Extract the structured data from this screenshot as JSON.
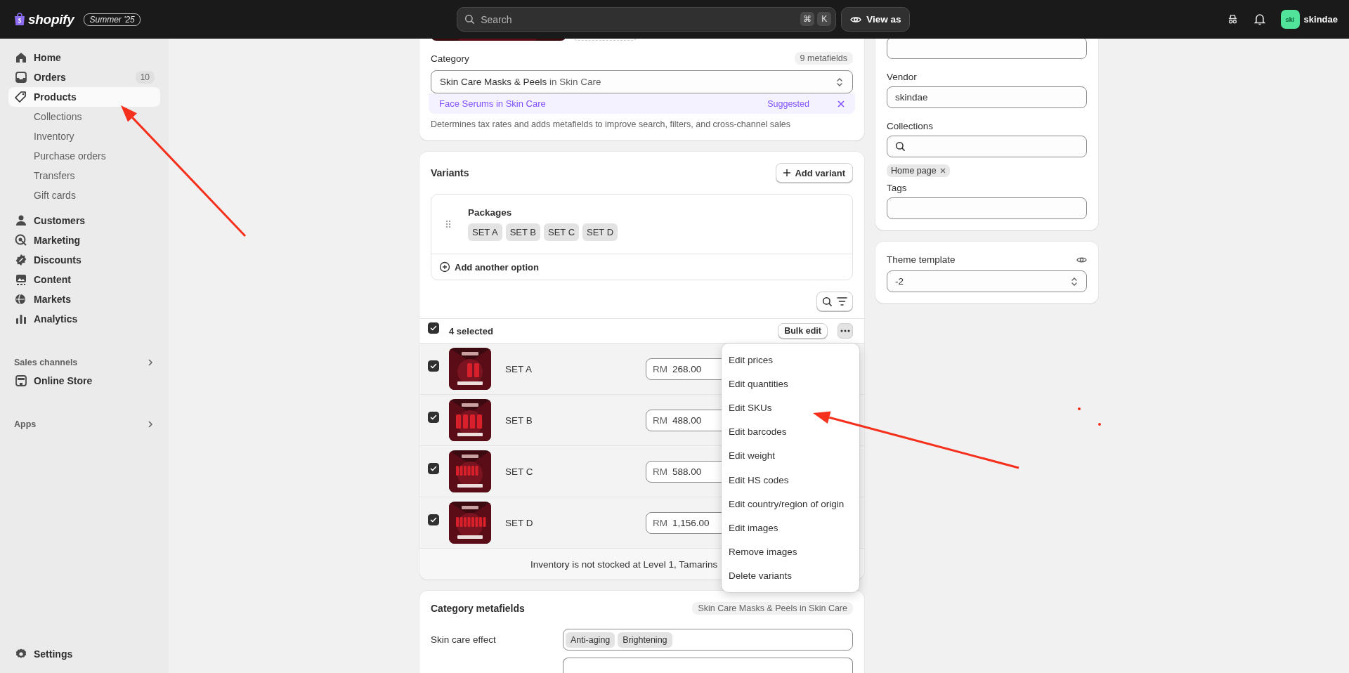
{
  "topbar": {
    "logo": "shopify",
    "edition": "Summer '25",
    "search": {
      "placeholder": "Search"
    },
    "shortcut_keys": [
      "⌘",
      "K"
    ],
    "view_as": "View as",
    "avatar": "ski",
    "store_name": "skindae"
  },
  "sidebar": {
    "items": [
      {
        "label": "Home",
        "selected": false
      },
      {
        "label": "Orders",
        "badge": "10",
        "selected": false
      },
      {
        "label": "Products",
        "selected": true,
        "children": [
          {
            "label": "Collections",
            "selected": false
          },
          {
            "label": "Inventory",
            "selected": false
          },
          {
            "label": "Purchase orders",
            "selected": false
          },
          {
            "label": "Transfers",
            "selected": false
          },
          {
            "label": "Gift cards",
            "selected": false
          }
        ]
      },
      {
        "label": "Customers",
        "selected": false
      },
      {
        "label": "Marketing",
        "selected": false
      },
      {
        "label": "Discounts",
        "selected": false
      },
      {
        "label": "Content",
        "selected": false
      },
      {
        "label": "Markets",
        "selected": false
      },
      {
        "label": "Analytics",
        "selected": false
      }
    ],
    "sections": [
      {
        "title": "Sales channels",
        "items": [
          {
            "label": "Online Store",
            "selected": false
          }
        ]
      },
      {
        "title": "Apps"
      }
    ],
    "footer": {
      "label": "Settings",
      "selected": false
    }
  },
  "category": {
    "label": "Category",
    "metafield_count": "9 metafields",
    "value": "Skin Care Masks & Peels",
    "value_parent": "in Skin Care",
    "suggestion": {
      "value": "Face Serums",
      "parent": "in Skin Care",
      "tag": "Suggested"
    },
    "description": "Determines tax rates and adds metafields to improve search, filters, and cross-channel sales"
  },
  "variants": {
    "title": "Variants",
    "add_button": "Add variant",
    "options": [
      {
        "name": "Packages",
        "values": [
          "SET A",
          "SET B",
          "SET C",
          "SET D"
        ]
      }
    ],
    "add_option": "Add another option",
    "selection": {
      "checked": true,
      "label": "4 selected",
      "bulk_edit": "Bulk edit",
      "menu_open": true
    },
    "rows": [
      {
        "name": "SET A",
        "checked": true,
        "currency": "RM",
        "price": "268.00"
      },
      {
        "name": "SET B",
        "checked": true,
        "currency": "RM",
        "price": "488.00"
      },
      {
        "name": "SET C",
        "checked": true,
        "currency": "RM",
        "price": "588.00"
      },
      {
        "name": "SET D",
        "checked": true,
        "currency": "RM",
        "price": "1,156.00"
      }
    ],
    "footer": "Inventory is not stocked at Level 1, Tamarins"
  },
  "bulk_menu": {
    "items": [
      "Edit prices",
      "Edit quantities",
      "Edit SKUs",
      "Edit barcodes",
      "Edit weight",
      "Edit HS codes",
      "Edit country/region of origin",
      "Edit images",
      "Remove images",
      "Delete variants"
    ]
  },
  "category_metafields": {
    "title": "Category metafields",
    "badge": "Skin Care Masks & Peels in Skin Care",
    "rows": [
      {
        "label": "Skin care effect",
        "values": [
          "Anti-aging",
          "Brightening"
        ]
      }
    ]
  },
  "organization": {
    "vendor": {
      "label": "Vendor",
      "value": "skindae"
    },
    "collections": {
      "label": "Collections",
      "chips": [
        "Home page"
      ]
    },
    "tags": {
      "label": "Tags"
    }
  },
  "theme_template": {
    "label": "Theme template",
    "value": "-2"
  },
  "annotations": [
    {
      "kind": "arrow"
    },
    {
      "kind": "arrow"
    },
    {
      "kind": "dot"
    },
    {
      "kind": "dot"
    }
  ]
}
